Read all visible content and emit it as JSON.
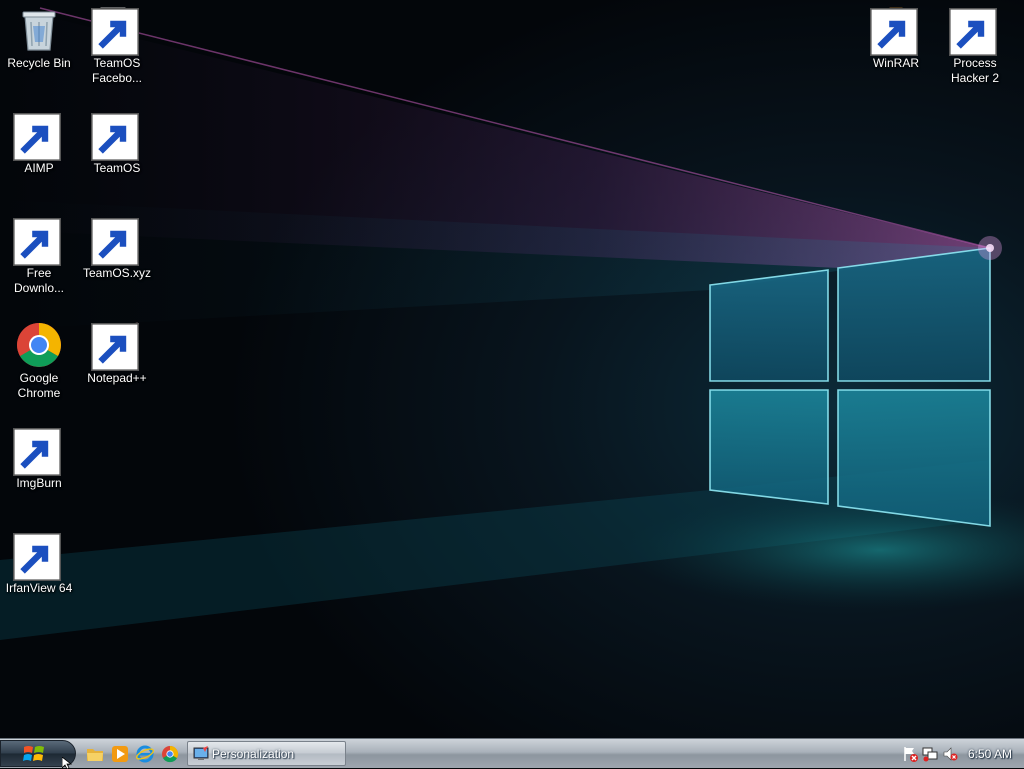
{
  "desktop": {
    "icons": [
      {
        "id": "recycle-bin",
        "label": "Recycle Bin"
      },
      {
        "id": "teamos-facebook",
        "label": "TeamOS Facebo..."
      },
      {
        "id": "winrar",
        "label": "WinRAR"
      },
      {
        "id": "process-hacker",
        "label": "Process Hacker 2"
      },
      {
        "id": "aimp",
        "label": "AIMP"
      },
      {
        "id": "teamos-folder",
        "label": "TeamOS"
      },
      {
        "id": "free-download",
        "label": "Free Downlo..."
      },
      {
        "id": "teamos-xyz",
        "label": "TeamOS.xyz"
      },
      {
        "id": "google-chrome",
        "label": "Google Chrome"
      },
      {
        "id": "notepadpp",
        "label": "Notepad++"
      },
      {
        "id": "imgburn",
        "label": "ImgBurn"
      },
      {
        "id": "irfanview",
        "label": "IrfanView 64"
      }
    ]
  },
  "taskbar": {
    "quick_launch": [
      "folder-icon",
      "media-player-icon",
      "internet-explorer-icon",
      "chrome-icon"
    ],
    "tasks": [
      {
        "label": "Personalization",
        "icon": "personalization-icon"
      }
    ],
    "tray": {
      "icons": [
        "action-center-flag-icon",
        "network-icon",
        "volume-muted-icon"
      ],
      "clock": "6:50 AM"
    }
  },
  "colors": {
    "wallpaper_glow_pink": "#e06ad0",
    "wallpaper_glow_cyan": "#36d6e6",
    "taskbar": "#a9b1ba"
  }
}
